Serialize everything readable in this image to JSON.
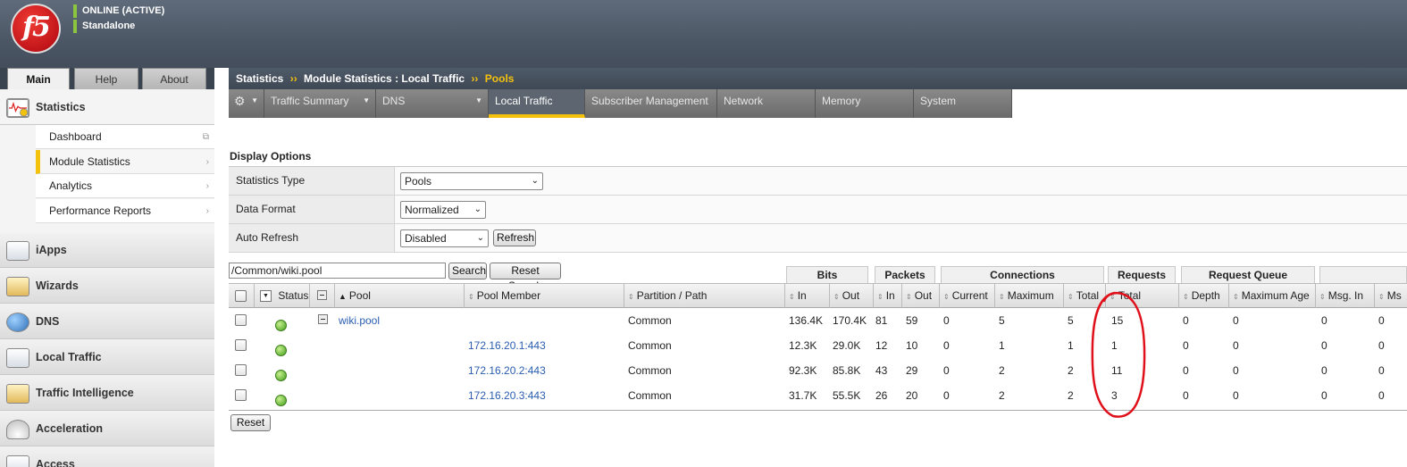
{
  "header": {
    "logo_text": "f5",
    "status": "ONLINE (ACTIVE)",
    "mode": "Standalone"
  },
  "sidebar": {
    "tabs": [
      "Main",
      "Help",
      "About"
    ],
    "statistics": {
      "label": "Statistics",
      "items": [
        "Dashboard",
        "Module Statistics",
        "Analytics",
        "Performance Reports"
      ]
    },
    "sections": [
      "iApps",
      "Wizards",
      "DNS",
      "Local Traffic",
      "Traffic Intelligence",
      "Acceleration",
      "Access"
    ]
  },
  "breadcrumb": {
    "part1": "Statistics",
    "part2": "Module Statistics : Local Traffic",
    "current": "Pools",
    "separator": "››"
  },
  "topnav": {
    "items": [
      "Traffic Summary",
      "DNS",
      "Local Traffic",
      "Subscriber Management",
      "Network",
      "Memory",
      "System"
    ],
    "active": "Local Traffic"
  },
  "display_options": {
    "title": "Display Options",
    "statistics_type": {
      "label": "Statistics Type",
      "value": "Pools"
    },
    "data_format": {
      "label": "Data Format",
      "value": "Normalized"
    },
    "auto_refresh": {
      "label": "Auto Refresh",
      "value": "Disabled"
    },
    "refresh_button": "Refresh"
  },
  "search": {
    "value": "/Common/wiki.pool",
    "search_button": "Search",
    "reset_button": "Reset Search"
  },
  "groups": [
    "Bits",
    "Packets",
    "Connections",
    "Requests",
    "Request Queue"
  ],
  "columns": {
    "status": "Status",
    "pool": "Pool",
    "pool_member": "Pool Member",
    "partition": "Partition / Path",
    "bits_in": "In",
    "bits_out": "Out",
    "pkts_in": "In",
    "pkts_out": "Out",
    "conn_current": "Current",
    "conn_maximum": "Maximum",
    "conn_total": "Total",
    "req_total": "Total",
    "rq_depth": "Depth",
    "rq_max_age": "Maximum Age",
    "rq_msg_in": "Msg. In",
    "rq_msg_out": "Ms"
  },
  "rows": [
    {
      "pool": "wiki.pool",
      "member": "",
      "partition": "Common",
      "bits_in": "136.4K",
      "bits_out": "170.4K",
      "pkts_in": "81",
      "pkts_out": "59",
      "current": "0",
      "maximum": "5",
      "total": "5",
      "req_total": "15",
      "depth": "0",
      "max_age": "0",
      "msg_in": "0",
      "msg_out": "0"
    },
    {
      "pool": "",
      "member": "172.16.20.1:443",
      "partition": "Common",
      "bits_in": "12.3K",
      "bits_out": "29.0K",
      "pkts_in": "12",
      "pkts_out": "10",
      "current": "0",
      "maximum": "1",
      "total": "1",
      "req_total": "1",
      "depth": "0",
      "max_age": "0",
      "msg_in": "0",
      "msg_out": "0"
    },
    {
      "pool": "",
      "member": "172.16.20.2:443",
      "partition": "Common",
      "bits_in": "92.3K",
      "bits_out": "85.8K",
      "pkts_in": "43",
      "pkts_out": "29",
      "current": "0",
      "maximum": "2",
      "total": "2",
      "req_total": "11",
      "depth": "0",
      "max_age": "0",
      "msg_in": "0",
      "msg_out": "0"
    },
    {
      "pool": "",
      "member": "172.16.20.3:443",
      "partition": "Common",
      "bits_in": "31.7K",
      "bits_out": "55.5K",
      "pkts_in": "26",
      "pkts_out": "20",
      "current": "0",
      "maximum": "2",
      "total": "2",
      "req_total": "3",
      "depth": "0",
      "max_age": "0",
      "msg_in": "0",
      "msg_out": "0"
    }
  ],
  "reset_button": "Reset",
  "colors": {
    "accent": "#f4c20d",
    "link": "#2a5db0",
    "annotation": "#e0101a",
    "status_green": "#8cc63f"
  }
}
